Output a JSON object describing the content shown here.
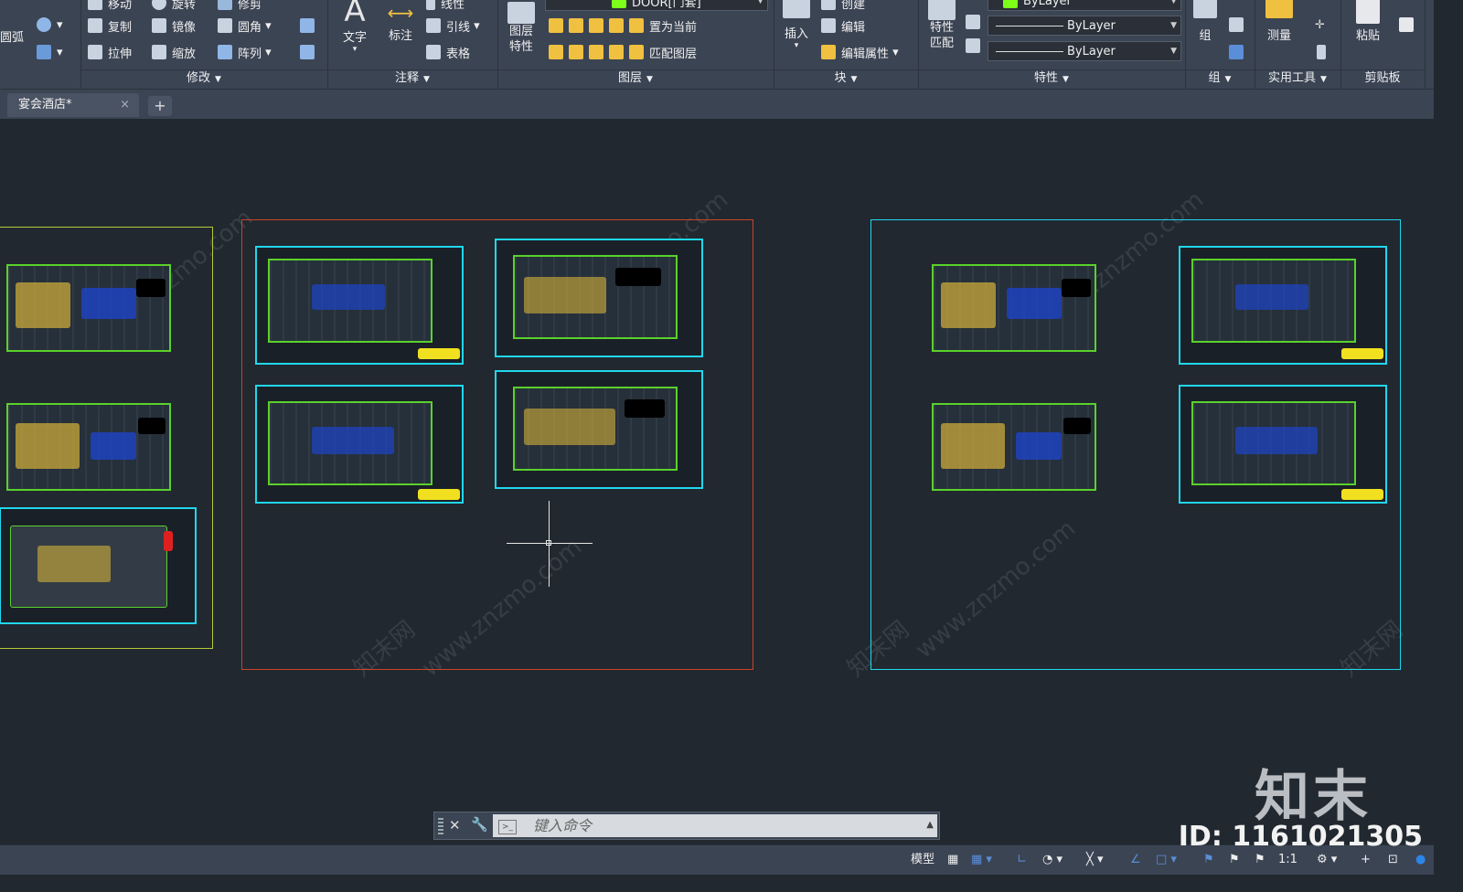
{
  "ribbon": {
    "draw_panel": {
      "arc_label": "圆弧"
    },
    "modify": {
      "label": "修改",
      "items": [
        "移动",
        "旋转",
        "修剪",
        "复制",
        "镜像",
        "圆角",
        "拉伸",
        "缩放",
        "阵列"
      ]
    },
    "annotation": {
      "label": "注释",
      "text_label": "文字",
      "dim_label": "标注",
      "leader_label": "引线",
      "table_label": "表格",
      "linear_label": "线性"
    },
    "layers": {
      "label": "图层",
      "properties_label": "图层\n特性",
      "current_layer": "DOOR[门套]",
      "set_current": "置为当前",
      "match_layer": "匹配图层"
    },
    "block": {
      "label": "块",
      "insert_label": "插入",
      "create_label": "创建",
      "edit_label": "编辑",
      "edit_attr_label": "编辑属性"
    },
    "properties": {
      "label": "特性",
      "match_label": "特性\n匹配",
      "color": "ByLayer",
      "linetype": "ByLayer",
      "lineweight": "ByLayer"
    },
    "groups": {
      "label": "组",
      "group_label": "组"
    },
    "utilities": {
      "label": "实用工具",
      "measure_label": "测量"
    },
    "clipboard": {
      "label": "剪贴板",
      "paste_label": "粘贴"
    }
  },
  "tabs": {
    "file_tab": "宴会酒店*",
    "close": "×",
    "add": "+"
  },
  "command": {
    "placeholder": "键入命令"
  },
  "status": {
    "model_label": "模型",
    "scale_label": "1:1"
  },
  "watermark": {
    "site": "www.znzmo.com",
    "brand": "知末",
    "id": "ID: 1161021305",
    "cn": "知末网"
  },
  "colors": {
    "background": "#212830",
    "ribbon": "#3b4453",
    "cyan_frame": "#21d7ec",
    "orange_frame": "#c8452a",
    "yellow_frame": "#b7c93a"
  }
}
